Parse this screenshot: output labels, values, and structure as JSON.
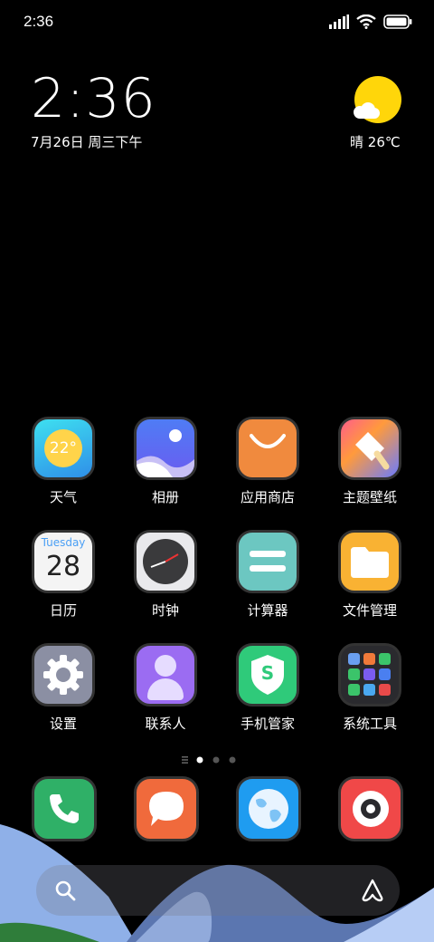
{
  "status_bar": {
    "time": "2:36",
    "icons": [
      "signal-icon",
      "wifi-icon",
      "battery-icon"
    ]
  },
  "clock_widget": {
    "time": "2:36",
    "date": "7月26日 周三下午"
  },
  "weather_widget": {
    "condition": "晴",
    "temperature": "26℃",
    "icon": "sunny-cloud-icon"
  },
  "apps": [
    {
      "label": "天气",
      "icon": "weather-app-icon",
      "temp": "22°"
    },
    {
      "label": "相册",
      "icon": "gallery-app-icon"
    },
    {
      "label": "应用商店",
      "icon": "app-store-icon"
    },
    {
      "label": "主题壁纸",
      "icon": "themes-icon"
    },
    {
      "label": "日历",
      "icon": "calendar-icon",
      "weekday": "Tuesday",
      "day": "28"
    },
    {
      "label": "时钟",
      "icon": "clock-app-icon"
    },
    {
      "label": "计算器",
      "icon": "calculator-icon"
    },
    {
      "label": "文件管理",
      "icon": "file-manager-icon"
    },
    {
      "label": "设置",
      "icon": "settings-gear-icon"
    },
    {
      "label": "联系人",
      "icon": "contacts-icon"
    },
    {
      "label": "手机管家",
      "icon": "security-shield-icon",
      "glyph": "S"
    },
    {
      "label": "系统工具",
      "icon": "system-tools-folder-icon"
    }
  ],
  "page_indicator": {
    "current": 1,
    "pages": 3
  },
  "dock": [
    {
      "name": "phone",
      "icon": "phone-icon"
    },
    {
      "name": "messages",
      "icon": "message-icon"
    },
    {
      "name": "browser",
      "icon": "browser-globe-icon"
    },
    {
      "name": "camera",
      "icon": "camera-icon"
    }
  ],
  "search_bar": {
    "left_icon": "search-icon",
    "right_icon": "assistant-icon"
  },
  "colors": {
    "background": "#000000",
    "sun": "#ffd60a",
    "wave_blue": "#8fb0e8",
    "wave_green": "#2f7d3a"
  }
}
